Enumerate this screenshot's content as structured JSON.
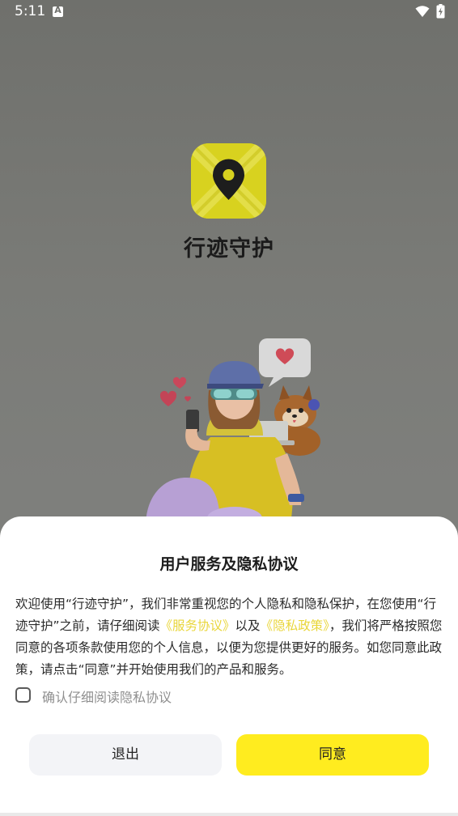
{
  "status_bar": {
    "time": "5:11",
    "notification_letter": "A",
    "icons": [
      "wifi-icon",
      "battery-charging-icon"
    ]
  },
  "app": {
    "name": "行迹守护",
    "logo_icon": "map-pin-icon",
    "brand_color": "#ffec1f"
  },
  "dialog": {
    "title": "用户服务及隐私协议",
    "body_part1": "欢迎使用“行迹守护”，我们非常重视您的个人隐私和隐私保护，在您使用“行迹守护”之前，请仔细阅读",
    "service_link": "《服务协议》",
    "body_part2": "以及",
    "privacy_link": "《隐私政策》",
    "body_part3": "，我们将严格按照您同意的各项条款使用您的个人信息，以便为您提供更好的服务。如您同意此政策，请点击“同意”并开始使用我们的产品和服务。",
    "confirm_label": "确认仔细阅读隐私协议",
    "confirm_checked": false,
    "exit_label": "退出",
    "agree_label": "同意",
    "link_color": "#e9d63a"
  }
}
